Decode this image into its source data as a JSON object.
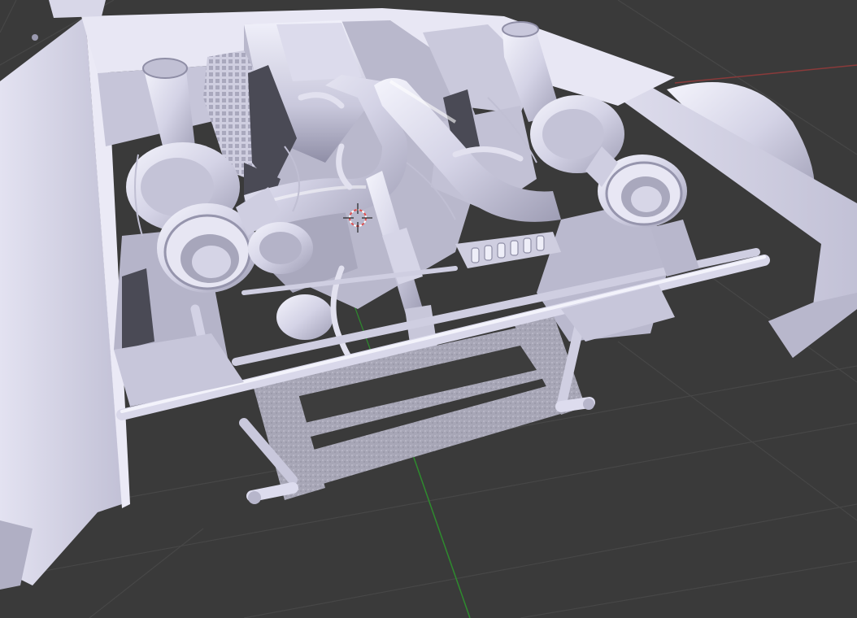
{
  "viewport": {
    "background": "#3a3a3a",
    "grid_color": "#474747",
    "x_axis_color": "#8a3a3a",
    "y_axis_color": "#2e8b2e"
  },
  "model": {
    "base_color": "#d3d2e6",
    "shadow_color": "#9c9bb3",
    "highlight_color": "#f2f2fb"
  },
  "cursor": {
    "icon": "3d-cursor-icon",
    "ring_colors": [
      "#e05050",
      "#ffffff"
    ]
  }
}
